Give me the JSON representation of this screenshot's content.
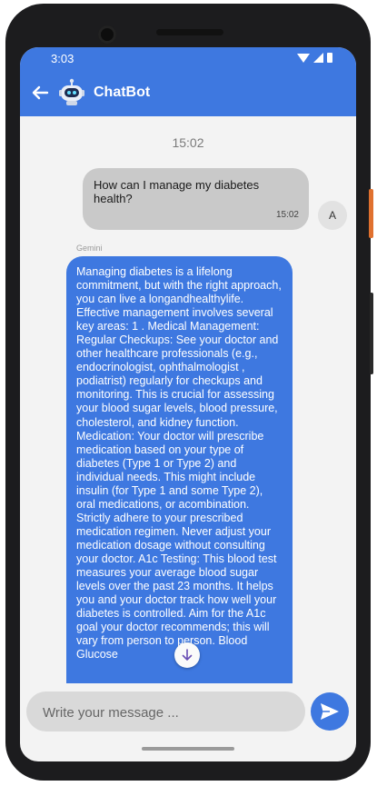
{
  "status_bar": {
    "time": "3:03"
  },
  "header": {
    "title": "ChatBot",
    "back_icon": "arrow-left-icon",
    "avatar_icon": "robot-icon",
    "color": "#3e78e0"
  },
  "chat": {
    "date_label": "15:02",
    "messages": [
      {
        "sender": "user",
        "text": "How can I manage my diabetes health?",
        "time": "15:02",
        "avatar_letter": "A"
      },
      {
        "sender": "bot",
        "sender_name": "Gemini",
        "text": "Managing diabetes is a lifelong commitment, but with the right approach, you can live a longandhealthylife. Effective management involves several key areas: 1 . Medical Management: Regular Checkups: See your doctor and other healthcare professionals (e.g., endocrinologist, ophthalmologist , podiatrist) regularly for checkups and monitoring. This is crucial for assessing your blood sugar levels, blood pressure, cholesterol, and kidney function. Medication: Your doctor will prescribe medication based on your type of diabetes (Type 1 or Type 2) and individual needs. This might include insulin (for Type 1 and some Type 2), oral medications, or acombination. Strictly adhere to your prescribed medication regimen. Never adjust your medication dosage without consulting your doctor.  A1c Testing: This blood test measures your average blood sugar levels over the past 23 months. It helps you and your doctor track how well your diabetes is controlled. Aim for the A1c goal your doctor recommends; this will vary from person to person.  Blood Glucose"
      }
    ],
    "scroll_down_icon": "arrow-down-icon"
  },
  "composer": {
    "placeholder": "Write your message ...",
    "value": "",
    "send_icon": "send-icon"
  },
  "colors": {
    "accent": "#3e78e0",
    "user_bubble": "#c9c9c9",
    "background": "#f3f3f3"
  }
}
